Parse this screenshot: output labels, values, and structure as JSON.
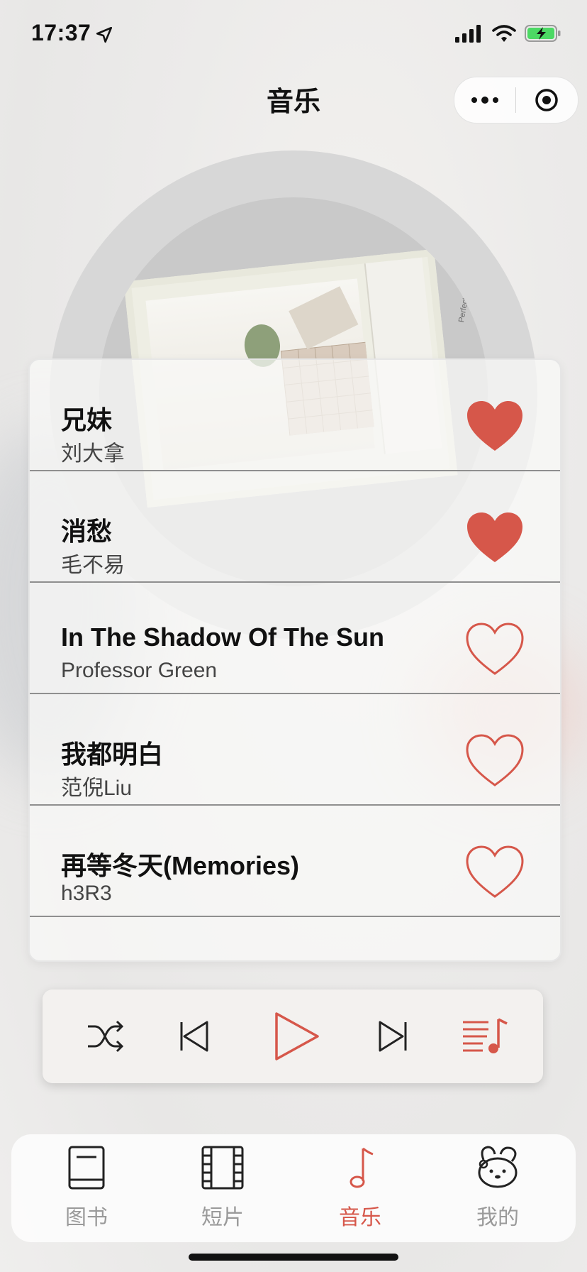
{
  "status_bar": {
    "time": "17:37"
  },
  "header": {
    "title": "音乐"
  },
  "disc": {
    "cover_text": "Perfect Day"
  },
  "songs": [
    {
      "title": "兄妹",
      "artist": "刘大拿",
      "liked": true
    },
    {
      "title": "消愁",
      "artist": "毛不易",
      "liked": true
    },
    {
      "title": "In The Shadow Of The Sun",
      "artist": "Professor Green",
      "liked": false
    },
    {
      "title": "我都明白",
      "artist": "范倪Liu",
      "liked": false
    },
    {
      "title": "再等冬天(Memories)",
      "artist": "h3R3",
      "liked": false
    }
  ],
  "player": {
    "controls": [
      "shuffle-icon",
      "previous-icon",
      "play-icon",
      "next-icon",
      "playlist-icon"
    ]
  },
  "tabs": [
    {
      "label": "图书",
      "icon": "book-icon",
      "active": false
    },
    {
      "label": "短片",
      "icon": "film-icon",
      "active": false
    },
    {
      "label": "音乐",
      "icon": "music-note-icon",
      "active": true
    },
    {
      "label": "我的",
      "icon": "profile-icon",
      "active": false
    }
  ],
  "colors": {
    "accent": "#d6574a",
    "inactive": "#9a9a9a",
    "heart": "#d6574a"
  }
}
